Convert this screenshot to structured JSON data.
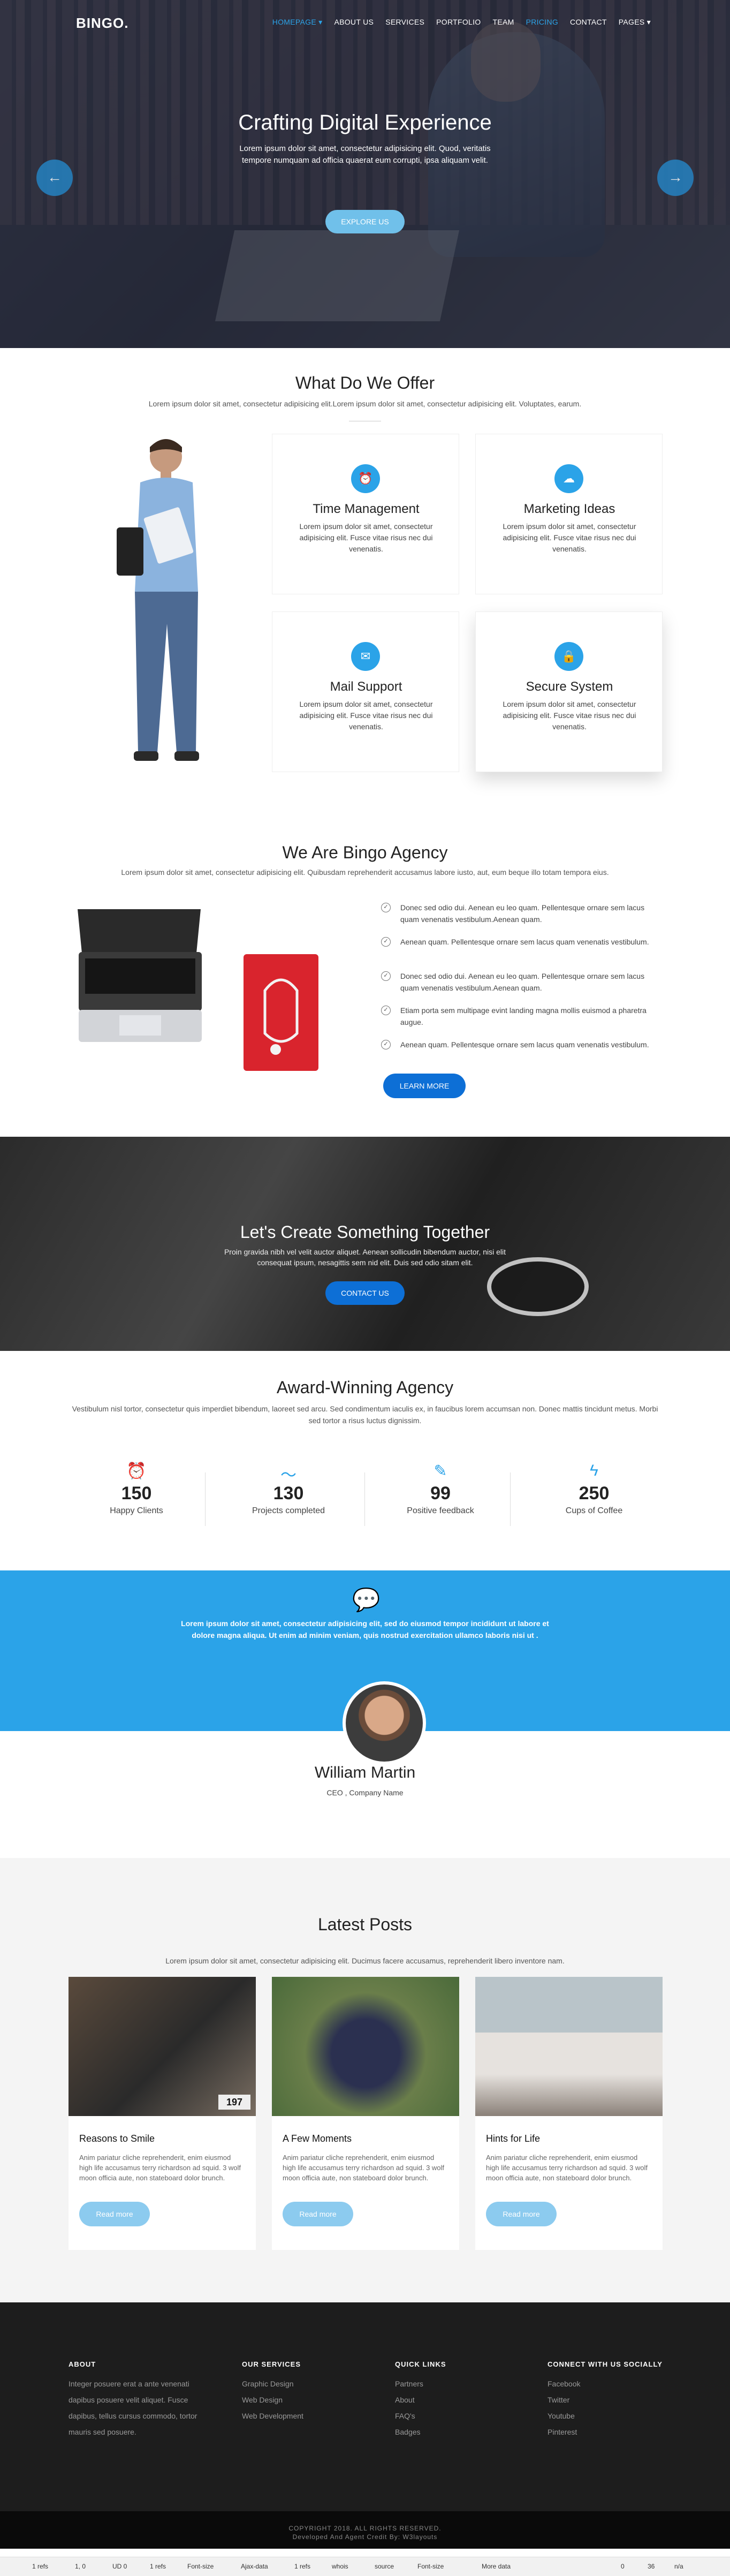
{
  "nav": {
    "logo": "BINGO.",
    "items": [
      "HOMEPAGE ▾",
      "ABOUT US",
      "SERVICES",
      "PORTFOLIO",
      "TEAM",
      "PRICING",
      "CONTACT",
      "PAGES ▾"
    ]
  },
  "hero": {
    "title": "Crafting Digital Experience",
    "text": "Lorem ipsum dolor sit amet, consectetur adipisicing elit. Quod, veritatis tempore numquam ad officia quaerat eum corrupti, ipsa aliquam velit.",
    "button": "EXPLORE US",
    "prev": "←",
    "next": "→"
  },
  "offer": {
    "title": "What Do We Offer",
    "subtitle": "Lorem ipsum dolor sit amet, consectetur adipisicing elit.Lorem ipsum dolor sit amet, consectetur adipisicing elit. Voluptates, earum.",
    "cards": [
      {
        "title": "Time Management",
        "text": "Lorem ipsum dolor sit amet, consectetur adipisicing elit. Fusce vitae risus nec dui venenatis.",
        "icon": "alarm-icon"
      },
      {
        "title": "Marketing Ideas",
        "text": "Lorem ipsum dolor sit amet, consectetur adipisicing elit. Fusce vitae risus nec dui venenatis.",
        "icon": "cloud-icon"
      },
      {
        "title": "Mail Support",
        "text": "Lorem ipsum dolor sit amet, consectetur adipisicing elit. Fusce vitae risus nec dui venenatis.",
        "icon": "mail-icon"
      },
      {
        "title": "Secure System",
        "text": "Lorem ipsum dolor sit amet, consectetur adipisicing elit. Fusce vitae risus nec dui venenatis.",
        "icon": "lock-icon"
      }
    ]
  },
  "agency": {
    "title": "We Are Bingo Agency",
    "subtitle": "Lorem ipsum dolor sit amet, consectetur adipisicing elit. Quibusdam reprehenderit accusamus labore iusto, aut, eum beque illo totam tempora eius.",
    "items": [
      "Donec sed odio dui. Aenean eu leo quam. Pellentesque ornare sem lacus quam venenatis vestibulum.Aenean quam.",
      "Aenean quam. Pellentesque ornare sem lacus quam venenatis vestibulum.",
      "Donec sed odio dui. Aenean eu leo quam. Pellentesque ornare sem lacus quam venenatis vestibulum.Aenean quam.",
      "Etiam porta sem multipage evint landing magna mollis euismod a pharetra augue.",
      "Aenean quam. Pellentesque ornare sem lacus quam venenatis vestibulum."
    ],
    "button": "LEARN MORE"
  },
  "cta": {
    "title": "Let's Create Something Together",
    "text": "Proin gravida nibh vel velit auctor aliquet. Aenean sollicudin bibendum auctor, nisi elit consequat ipsum, nesagittis sem nid elit. Duis sed odio sitam elit.",
    "button": "CONTACT US"
  },
  "award": {
    "title": "Award-Winning Agency",
    "text": "Vestibulum nisl tortor, consectetur quis imperdiet bibendum, laoreet sed arcu. Sed condimentum iaculis ex, in faucibus lorem accumsan non. Donec mattis tincidunt metus. Morbi sed tortor a risus luctus dignissim.",
    "stats": [
      {
        "num": "150",
        "label": "Happy Clients",
        "icon": "alarm-clock-icon"
      },
      {
        "num": "130",
        "label": "Projects completed",
        "icon": "chart-line-icon"
      },
      {
        "num": "99",
        "label": "Positive feedback",
        "icon": "edit-icon"
      },
      {
        "num": "250",
        "label": "Cups of Coffee",
        "icon": "bolt-icon"
      }
    ]
  },
  "testimonial": {
    "quote": "Lorem ipsum dolor sit amet, consectetur adipisicing elit, sed do eiusmod tempor incididunt ut labore et dolore magna aliqua. Ut enim ad minim veniam, quis nostrud exercitation ullamco laboris nisi ut .",
    "name": "William Martin",
    "role": "CEO , Company Name"
  },
  "posts": {
    "title": "Latest Posts",
    "subtitle": "Lorem ipsum dolor sit amet, consectetur adipisicing elit. Ducimus facere accusamus, reprehenderit libero inventore nam.",
    "items": [
      {
        "title": "Reasons to Smile",
        "text": "Anim pariatur cliche reprehenderit, enim eiusmod high life accusamus terry richardson ad squid. 3 wolf moon officia aute, non stateboard dolor brunch.",
        "button": "Read more",
        "badge": "197"
      },
      {
        "title": "A Few Moments",
        "text": "Anim pariatur cliche reprehenderit, enim eiusmod high life accusamus terry richardson ad squid. 3 wolf moon officia aute, non stateboard dolor brunch.",
        "button": "Read more"
      },
      {
        "title": "Hints for Life",
        "text": "Anim pariatur cliche reprehenderit, enim eiusmod high life accusamus terry richardson ad squid. 3 wolf moon officia aute, non stateboard dolor brunch.",
        "button": "Read more"
      }
    ]
  },
  "footer": {
    "about": {
      "title": "ABOUT",
      "text": "Integer posuere erat a ante venenati dapibus posuere velit aliquet. Fusce dapibus, tellus cursus commodo, tortor mauris sed posuere."
    },
    "services": {
      "title": "OUR SERVICES",
      "items": [
        "Graphic Design",
        "Web Design",
        "Web Development"
      ]
    },
    "links": {
      "title": "QUICK LINKS",
      "items": [
        "Partners",
        "About",
        "FAQ's",
        "Badges"
      ]
    },
    "social": {
      "title": "CONNECT WITH US SOCIALLY",
      "items": [
        "Facebook",
        "Twitter",
        "Youtube",
        "Pinterest"
      ]
    },
    "copyright": "COPYRIGHT 2018. ALL RIGHTS RESERVED.",
    "credit": "Developed And Agent Credit By: W3layouts"
  },
  "statusbar": [
    "1 refs",
    "1, 0",
    "UD 0",
    "1 refs",
    "Font-size",
    "Ajax-data",
    "1 refs",
    "whois",
    "source",
    "Font-size",
    "More data",
    "0",
    "36",
    "n/a"
  ]
}
